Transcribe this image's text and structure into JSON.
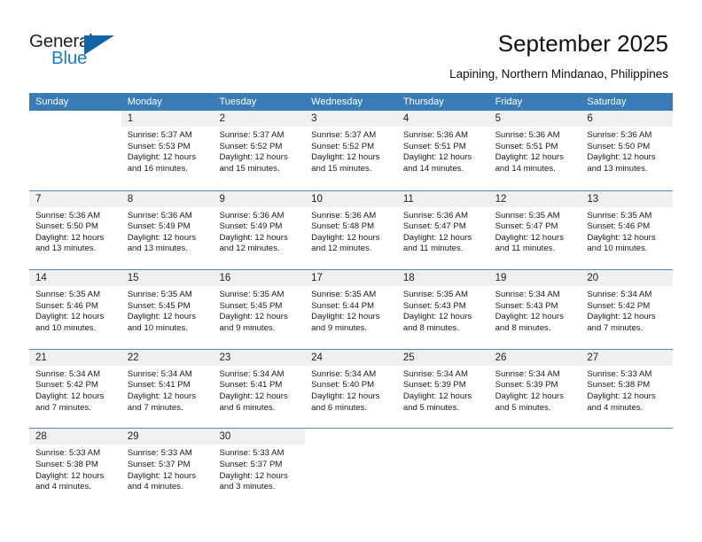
{
  "brand": {
    "name_top": "General",
    "name_bottom": "Blue",
    "accent_color": "#1064a8",
    "blue_text_color": "#1f7ac4"
  },
  "header": {
    "title": "September 2025",
    "subtitle": "Lapining, Northern Mindanao, Philippines"
  },
  "calendar": {
    "header_color": "#3a7cb8",
    "weekdays": [
      "Sunday",
      "Monday",
      "Tuesday",
      "Wednesday",
      "Thursday",
      "Friday",
      "Saturday"
    ],
    "labels": {
      "sunrise": "Sunrise:",
      "sunset": "Sunset:",
      "daylight": "Daylight:"
    },
    "weeks": [
      [
        {
          "day": "",
          "sunrise": "",
          "sunset": "",
          "daylight_1": "",
          "daylight_2": ""
        },
        {
          "day": "1",
          "sunrise": "Sunrise: 5:37 AM",
          "sunset": "Sunset: 5:53 PM",
          "daylight_1": "Daylight: 12 hours",
          "daylight_2": "and 16 minutes."
        },
        {
          "day": "2",
          "sunrise": "Sunrise: 5:37 AM",
          "sunset": "Sunset: 5:52 PM",
          "daylight_1": "Daylight: 12 hours",
          "daylight_2": "and 15 minutes."
        },
        {
          "day": "3",
          "sunrise": "Sunrise: 5:37 AM",
          "sunset": "Sunset: 5:52 PM",
          "daylight_1": "Daylight: 12 hours",
          "daylight_2": "and 15 minutes."
        },
        {
          "day": "4",
          "sunrise": "Sunrise: 5:36 AM",
          "sunset": "Sunset: 5:51 PM",
          "daylight_1": "Daylight: 12 hours",
          "daylight_2": "and 14 minutes."
        },
        {
          "day": "5",
          "sunrise": "Sunrise: 5:36 AM",
          "sunset": "Sunset: 5:51 PM",
          "daylight_1": "Daylight: 12 hours",
          "daylight_2": "and 14 minutes."
        },
        {
          "day": "6",
          "sunrise": "Sunrise: 5:36 AM",
          "sunset": "Sunset: 5:50 PM",
          "daylight_1": "Daylight: 12 hours",
          "daylight_2": "and 13 minutes."
        }
      ],
      [
        {
          "day": "7",
          "sunrise": "Sunrise: 5:36 AM",
          "sunset": "Sunset: 5:50 PM",
          "daylight_1": "Daylight: 12 hours",
          "daylight_2": "and 13 minutes."
        },
        {
          "day": "8",
          "sunrise": "Sunrise: 5:36 AM",
          "sunset": "Sunset: 5:49 PM",
          "daylight_1": "Daylight: 12 hours",
          "daylight_2": "and 13 minutes."
        },
        {
          "day": "9",
          "sunrise": "Sunrise: 5:36 AM",
          "sunset": "Sunset: 5:49 PM",
          "daylight_1": "Daylight: 12 hours",
          "daylight_2": "and 12 minutes."
        },
        {
          "day": "10",
          "sunrise": "Sunrise: 5:36 AM",
          "sunset": "Sunset: 5:48 PM",
          "daylight_1": "Daylight: 12 hours",
          "daylight_2": "and 12 minutes."
        },
        {
          "day": "11",
          "sunrise": "Sunrise: 5:36 AM",
          "sunset": "Sunset: 5:47 PM",
          "daylight_1": "Daylight: 12 hours",
          "daylight_2": "and 11 minutes."
        },
        {
          "day": "12",
          "sunrise": "Sunrise: 5:35 AM",
          "sunset": "Sunset: 5:47 PM",
          "daylight_1": "Daylight: 12 hours",
          "daylight_2": "and 11 minutes."
        },
        {
          "day": "13",
          "sunrise": "Sunrise: 5:35 AM",
          "sunset": "Sunset: 5:46 PM",
          "daylight_1": "Daylight: 12 hours",
          "daylight_2": "and 10 minutes."
        }
      ],
      [
        {
          "day": "14",
          "sunrise": "Sunrise: 5:35 AM",
          "sunset": "Sunset: 5:46 PM",
          "daylight_1": "Daylight: 12 hours",
          "daylight_2": "and 10 minutes."
        },
        {
          "day": "15",
          "sunrise": "Sunrise: 5:35 AM",
          "sunset": "Sunset: 5:45 PM",
          "daylight_1": "Daylight: 12 hours",
          "daylight_2": "and 10 minutes."
        },
        {
          "day": "16",
          "sunrise": "Sunrise: 5:35 AM",
          "sunset": "Sunset: 5:45 PM",
          "daylight_1": "Daylight: 12 hours",
          "daylight_2": "and 9 minutes."
        },
        {
          "day": "17",
          "sunrise": "Sunrise: 5:35 AM",
          "sunset": "Sunset: 5:44 PM",
          "daylight_1": "Daylight: 12 hours",
          "daylight_2": "and 9 minutes."
        },
        {
          "day": "18",
          "sunrise": "Sunrise: 5:35 AM",
          "sunset": "Sunset: 5:43 PM",
          "daylight_1": "Daylight: 12 hours",
          "daylight_2": "and 8 minutes."
        },
        {
          "day": "19",
          "sunrise": "Sunrise: 5:34 AM",
          "sunset": "Sunset: 5:43 PM",
          "daylight_1": "Daylight: 12 hours",
          "daylight_2": "and 8 minutes."
        },
        {
          "day": "20",
          "sunrise": "Sunrise: 5:34 AM",
          "sunset": "Sunset: 5:42 PM",
          "daylight_1": "Daylight: 12 hours",
          "daylight_2": "and 7 minutes."
        }
      ],
      [
        {
          "day": "21",
          "sunrise": "Sunrise: 5:34 AM",
          "sunset": "Sunset: 5:42 PM",
          "daylight_1": "Daylight: 12 hours",
          "daylight_2": "and 7 minutes."
        },
        {
          "day": "22",
          "sunrise": "Sunrise: 5:34 AM",
          "sunset": "Sunset: 5:41 PM",
          "daylight_1": "Daylight: 12 hours",
          "daylight_2": "and 7 minutes."
        },
        {
          "day": "23",
          "sunrise": "Sunrise: 5:34 AM",
          "sunset": "Sunset: 5:41 PM",
          "daylight_1": "Daylight: 12 hours",
          "daylight_2": "and 6 minutes."
        },
        {
          "day": "24",
          "sunrise": "Sunrise: 5:34 AM",
          "sunset": "Sunset: 5:40 PM",
          "daylight_1": "Daylight: 12 hours",
          "daylight_2": "and 6 minutes."
        },
        {
          "day": "25",
          "sunrise": "Sunrise: 5:34 AM",
          "sunset": "Sunset: 5:39 PM",
          "daylight_1": "Daylight: 12 hours",
          "daylight_2": "and 5 minutes."
        },
        {
          "day": "26",
          "sunrise": "Sunrise: 5:34 AM",
          "sunset": "Sunset: 5:39 PM",
          "daylight_1": "Daylight: 12 hours",
          "daylight_2": "and 5 minutes."
        },
        {
          "day": "27",
          "sunrise": "Sunrise: 5:33 AM",
          "sunset": "Sunset: 5:38 PM",
          "daylight_1": "Daylight: 12 hours",
          "daylight_2": "and 4 minutes."
        }
      ],
      [
        {
          "day": "28",
          "sunrise": "Sunrise: 5:33 AM",
          "sunset": "Sunset: 5:38 PM",
          "daylight_1": "Daylight: 12 hours",
          "daylight_2": "and 4 minutes."
        },
        {
          "day": "29",
          "sunrise": "Sunrise: 5:33 AM",
          "sunset": "Sunset: 5:37 PM",
          "daylight_1": "Daylight: 12 hours",
          "daylight_2": "and 4 minutes."
        },
        {
          "day": "30",
          "sunrise": "Sunrise: 5:33 AM",
          "sunset": "Sunset: 5:37 PM",
          "daylight_1": "Daylight: 12 hours",
          "daylight_2": "and 3 minutes."
        },
        {
          "day": "",
          "sunrise": "",
          "sunset": "",
          "daylight_1": "",
          "daylight_2": ""
        },
        {
          "day": "",
          "sunrise": "",
          "sunset": "",
          "daylight_1": "",
          "daylight_2": ""
        },
        {
          "day": "",
          "sunrise": "",
          "sunset": "",
          "daylight_1": "",
          "daylight_2": ""
        },
        {
          "day": "",
          "sunrise": "",
          "sunset": "",
          "daylight_1": "",
          "daylight_2": ""
        }
      ]
    ]
  }
}
